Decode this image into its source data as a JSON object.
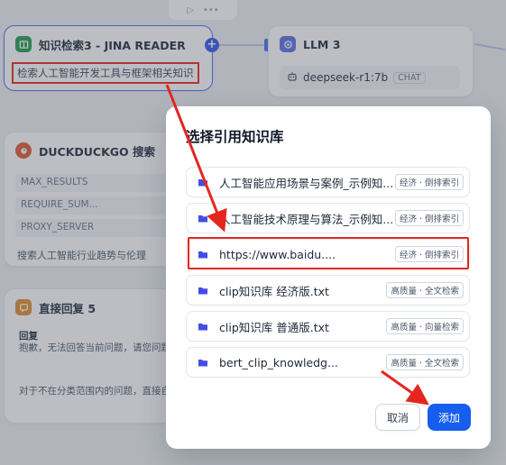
{
  "toolbar": {
    "play_icon": "play-icon",
    "more_icon": "more-icon",
    "more_label": "•••"
  },
  "kb_node": {
    "title": "知识检索3 - JINA READER",
    "query": "检索人工智能开发工具与框架相关知识",
    "icon": "book-icon",
    "color": "#1e9b4d"
  },
  "llm_node": {
    "title": "LLM 3",
    "model": "deepseek-r1:7b",
    "mode_tag": "CHAT",
    "color": "#5b6ee1"
  },
  "ddg_node": {
    "title": "DUCKDUCKGO 搜索",
    "params": [
      "MAX_RESULTS",
      "REQUIRE_SUM...",
      "PROXY_SERVER"
    ],
    "description": "搜索人工智能行业趋势与伦理"
  },
  "reply_node": {
    "title": "直接回复 5",
    "label": "回复",
    "text": "抱歉，无法回答当前问题，请您问题进行提问",
    "description": "对于不在分类范围内的问题，直接自定义的回复",
    "color": "#e08b2d"
  },
  "modal": {
    "title": "选择引用知识库",
    "items": [
      {
        "name": "人工智能应用场景与案例_示例知...",
        "tag": "经济 · 倒排索引"
      },
      {
        "name": "人工智能技术原理与算法_示例知...",
        "tag": "经济 · 倒排索引"
      },
      {
        "name": "https://www.baidu....",
        "tag": "经济 · 倒排索引"
      },
      {
        "name": "clip知识库 经济版.txt",
        "tag": "高质量 · 全文检索"
      },
      {
        "name": "clip知识库 普通版.txt",
        "tag": "高质量 · 向量检索"
      },
      {
        "name": "bert_clip_knowledg...",
        "tag": "高质量 · 全文检索"
      }
    ],
    "cancel_label": "取消",
    "add_label": "添加"
  },
  "colors": {
    "accent": "#155eef",
    "annotation": "#e5261f",
    "folder": "#444ce7"
  }
}
